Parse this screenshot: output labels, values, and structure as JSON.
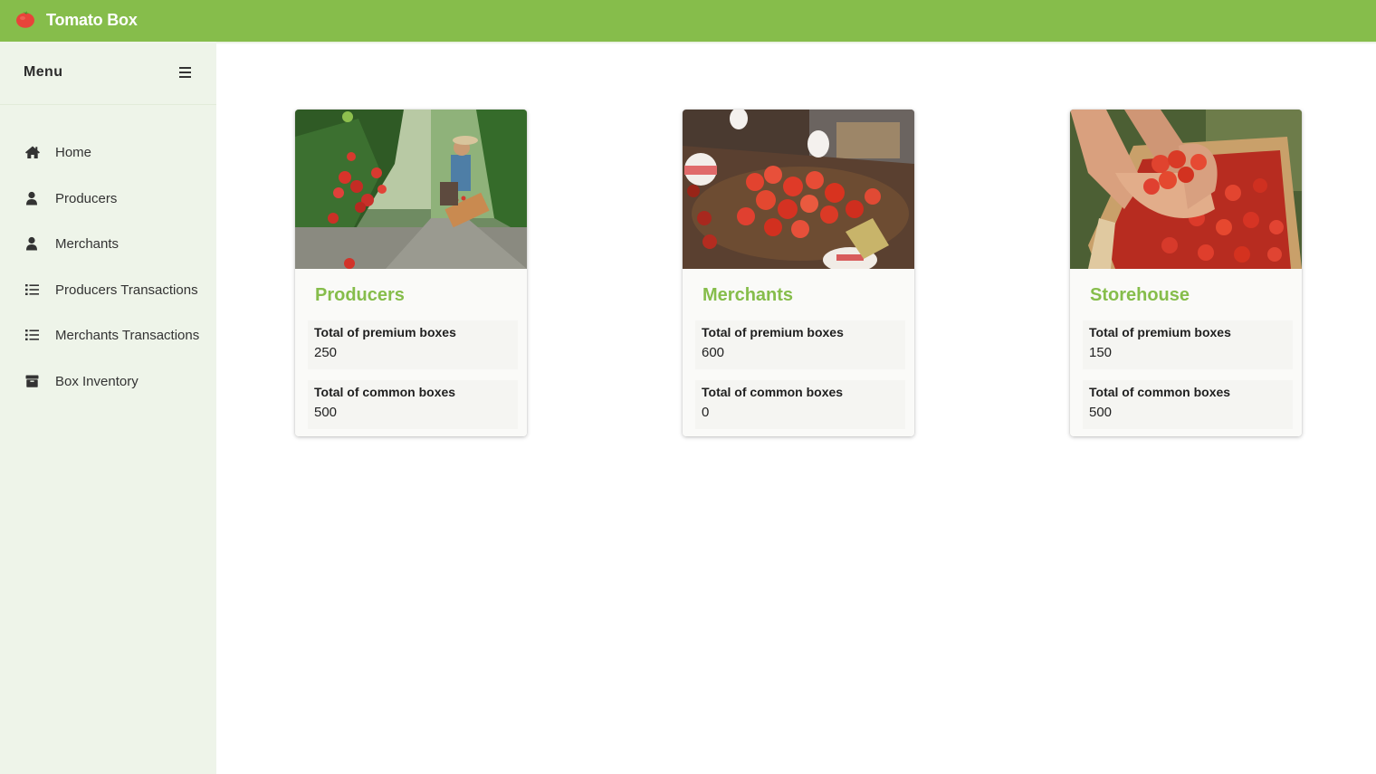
{
  "app": {
    "title": "Tomato Box"
  },
  "sidebar": {
    "menu_title": "Menu",
    "items": [
      {
        "label": "Home",
        "icon": "home-icon"
      },
      {
        "label": "Producers",
        "icon": "user-icon"
      },
      {
        "label": "Merchants",
        "icon": "user-icon"
      },
      {
        "label": "Producers Transactions",
        "icon": "list-icon"
      },
      {
        "label": "Merchants Transactions",
        "icon": "list-icon"
      },
      {
        "label": "Box Inventory",
        "icon": "box-icon"
      }
    ]
  },
  "cards": [
    {
      "title": "Producers",
      "premium_label": "Total of premium boxes",
      "premium_value": "250",
      "common_label": "Total of common boxes",
      "common_value": "500"
    },
    {
      "title": "Merchants",
      "premium_label": "Total of premium boxes",
      "premium_value": "600",
      "common_label": "Total of common boxes",
      "common_value": "0"
    },
    {
      "title": "Storehouse",
      "premium_label": "Total of premium boxes",
      "premium_value": "150",
      "common_label": "Total of common boxes",
      "common_value": "500"
    }
  ],
  "colors": {
    "brand": "#86bd4b",
    "sidebar_bg": "#eef4e9"
  }
}
